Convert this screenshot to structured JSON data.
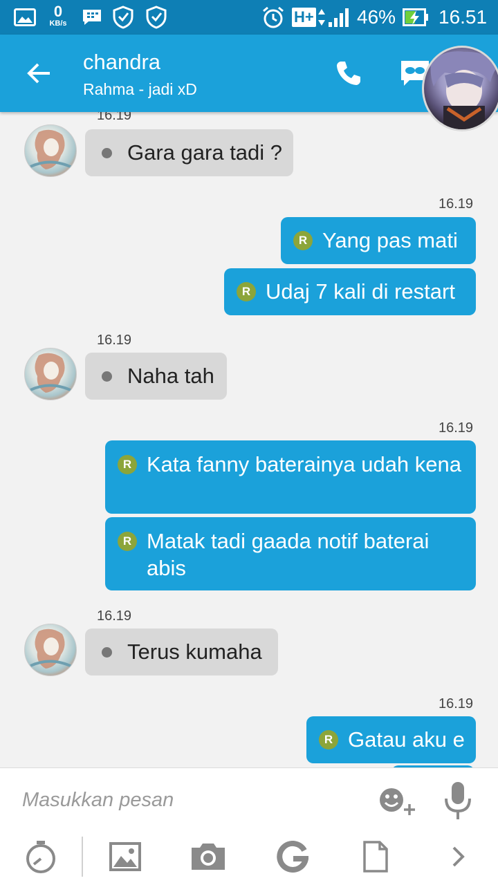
{
  "status_bar": {
    "speed_value": "0",
    "speed_unit": "KB/s",
    "network": "H+",
    "battery": "46%",
    "time": "16.51"
  },
  "header": {
    "name": "chandra",
    "status": "Rahma - jadi xD"
  },
  "messages": [
    {
      "direction": "in",
      "time": "16.19",
      "text": "Gara gara tadi ?"
    },
    {
      "direction": "out",
      "time": "16.19",
      "text": "Yang pas mati"
    },
    {
      "direction": "out",
      "text": "Udaj 7 kali di restart"
    },
    {
      "direction": "in",
      "time": "16.19",
      "text": "Naha tah"
    },
    {
      "direction": "out",
      "time": "16.19",
      "text": "Kata fanny baterainya udah kena"
    },
    {
      "direction": "out",
      "text": "Matak tadi gaada notif baterai abis"
    },
    {
      "direction": "in",
      "time": "16.19",
      "text": "Terus kumaha"
    },
    {
      "direction": "out",
      "time": "16.19",
      "text": "Gatau aku e"
    }
  ],
  "read_badge": "R",
  "input": {
    "placeholder": "Masukkan pesan"
  },
  "colors": {
    "header": "#1ba1da",
    "status_bar": "#0e7fb5",
    "bubble_out": "#1ba1da",
    "bubble_in": "#d8d8d8",
    "read_badge": "#8ca53a"
  },
  "icons": {
    "toolbar": [
      "timer-icon",
      "image-icon",
      "camera-icon",
      "google-icon",
      "file-icon",
      "chevron-right-icon"
    ]
  }
}
